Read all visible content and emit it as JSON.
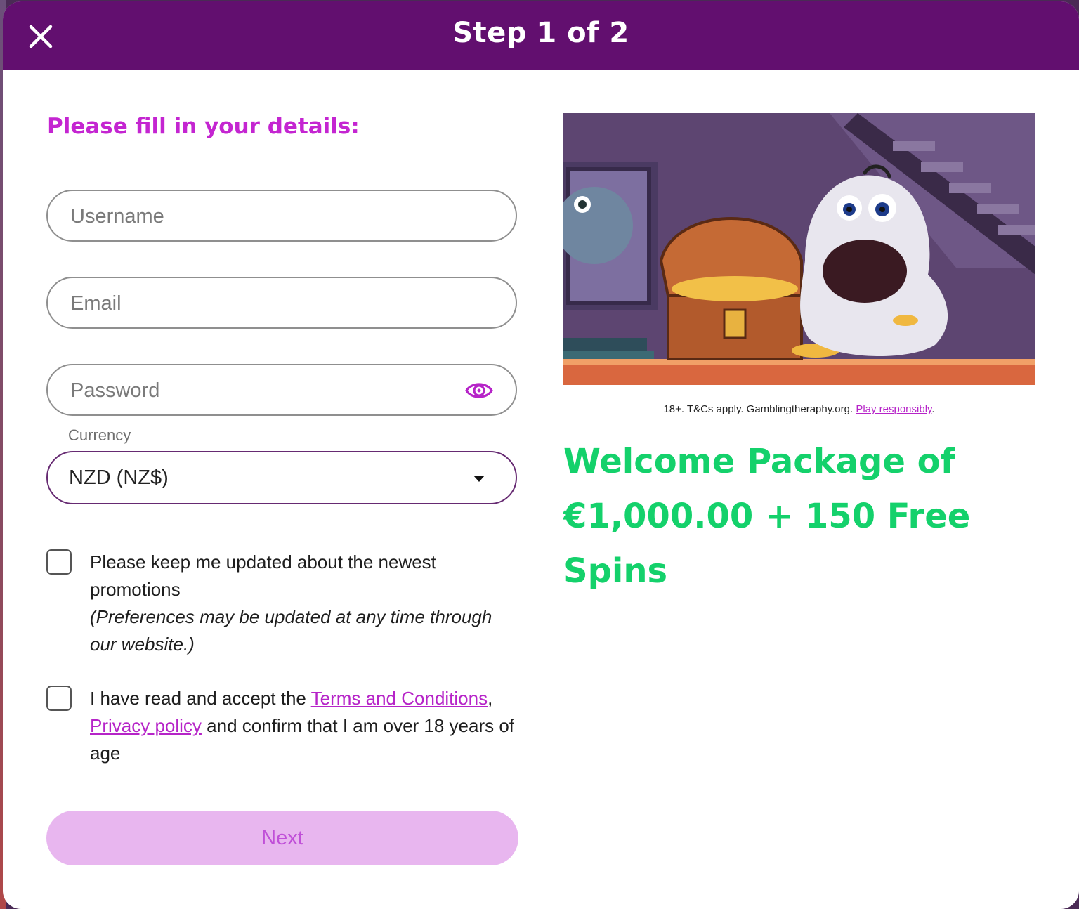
{
  "header": {
    "title": "Step 1 of 2",
    "close_icon": "close-icon"
  },
  "form": {
    "heading": "Please fill in your details:",
    "username_placeholder": "Username",
    "email_placeholder": "Email",
    "password_placeholder": "Password",
    "password_toggle_icon": "eye-icon",
    "currency_label": "Currency",
    "currency_value": "NZD (NZ$)",
    "promotions_text": "Please keep me updated about the newest promotions",
    "promotions_note": "(Preferences may be updated at any time through our website.)",
    "terms_prefix": "I have read and accept the ",
    "terms_link": "Terms and Conditions",
    "terms_comma": ",",
    "privacy_link": "Privacy policy",
    "terms_suffix": " and confirm that I am over 18 years of age",
    "next_label": "Next"
  },
  "promo": {
    "disclaimer_text": "18+. T&Cs apply. Gamblingtheraphy.org. ",
    "disclaimer_link": "Play responsibly",
    "disclaimer_end": ".",
    "welcome_text": "Welcome Package of €1,000.00 + 150 Free Spins"
  },
  "colors": {
    "header_bg": "#620f6f",
    "accent_purple": "#c425d1",
    "accent_green": "#14d16b",
    "button_disabled_bg": "#e8b6ef"
  }
}
